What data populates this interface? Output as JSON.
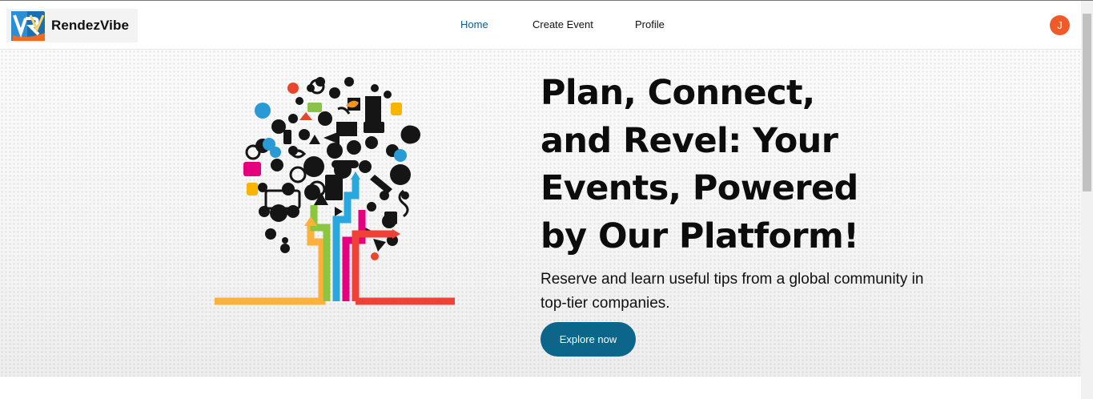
{
  "brand": {
    "name": "RendezVibe",
    "logo_icon": "rv-logo-icon"
  },
  "nav": {
    "links": [
      {
        "label": "Home",
        "active": true
      },
      {
        "label": "Create Event",
        "active": false
      },
      {
        "label": "Profile",
        "active": false
      }
    ],
    "avatar_initial": "J"
  },
  "hero": {
    "headline": "Plan, Connect, and Revel: Your Events, Powered by Our Platform!",
    "subtext": "Reserve and learn useful tips from a global community in top-tier companies.",
    "cta_label": "Explore now",
    "illustration_icon": "icon-tree-illustration"
  },
  "colors": {
    "accent": "#0b6689",
    "nav_active": "#0a5c8a",
    "avatar_bg": "#f05a28",
    "tree_branches": [
      "#fbb13c",
      "#8cc63f",
      "#29a8df",
      "#e6007e",
      "#ef4136"
    ]
  }
}
